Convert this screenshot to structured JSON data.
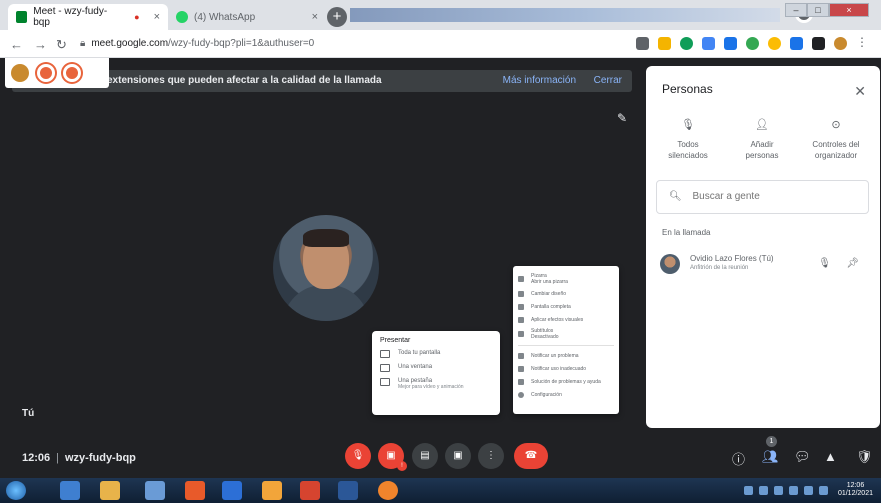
{
  "browser": {
    "tabs": [
      {
        "label": "Meet - wzy-fudy-bqp",
        "favicon_color": "#00832d",
        "active": true
      },
      {
        "label": "(4) WhatsApp",
        "favicon_color": "#25d366",
        "active": false
      }
    ],
    "url_host": "meet.google.com",
    "url_path": "/wzy-fudy-bqp?pli=1&authuser=0",
    "extension_colors": [
      "#5f6368",
      "#f4b400",
      "#0f9d58",
      "#4285f4",
      "#1a73e8",
      "#34a853",
      "#fbbc04",
      "#1a73e8",
      "#202124",
      "#c98a2e"
    ]
  },
  "banner": {
    "text": "extensiones que pueden afectar a la calidad de la llamada",
    "more_label": "Más información",
    "close_label": "Cerrar"
  },
  "self": {
    "label": "Tú"
  },
  "present_menu": {
    "title": "Presentar",
    "items": [
      {
        "label": "Toda tu pantalla",
        "sub": ""
      },
      {
        "label": "Una ventana",
        "sub": ""
      },
      {
        "label": "Una pestaña",
        "sub": "Mejor para vídeo y animación"
      }
    ]
  },
  "more_menu": {
    "items": [
      {
        "label": "Pizarra",
        "sub": "Abrir una pizarra"
      },
      {
        "label": "Cambiar diseño"
      },
      {
        "label": "Pantalla completa"
      },
      {
        "label": "Aplicar efectos visuales"
      },
      {
        "label": "Subtítulos",
        "sub": "Desactivado"
      },
      {
        "label": "Notificar un problema"
      },
      {
        "label": "Notificar uso inadecuado"
      },
      {
        "label": "Solución de problemas y ayuda"
      },
      {
        "label": "Configuración"
      }
    ]
  },
  "people": {
    "title": "Personas",
    "actions": [
      {
        "line1": "Todos",
        "line2": "silenciados"
      },
      {
        "line1": "Añadir",
        "line2": "personas"
      },
      {
        "line1": "Controles del",
        "line2": "organizador"
      }
    ],
    "search_placeholder": "Buscar a gente",
    "section_label": "En la llamada",
    "participants": [
      {
        "name": "Ovidio Lazo Flores (Tú)",
        "role": "Anfitrión de la reunión"
      }
    ]
  },
  "meeting": {
    "time": "12:06",
    "code": "wzy-fudy-bqp",
    "people_count": "1"
  },
  "taskbar": {
    "time": "12:06",
    "date": "01/12/2021",
    "app_colors": [
      "#3f7fd0",
      "#e8b34a",
      "#6a9bd6",
      "#e85a2a",
      "#2c6fd6",
      "#f2a53a",
      "#d6442f",
      "#2b5797",
      "#f0842c"
    ]
  }
}
